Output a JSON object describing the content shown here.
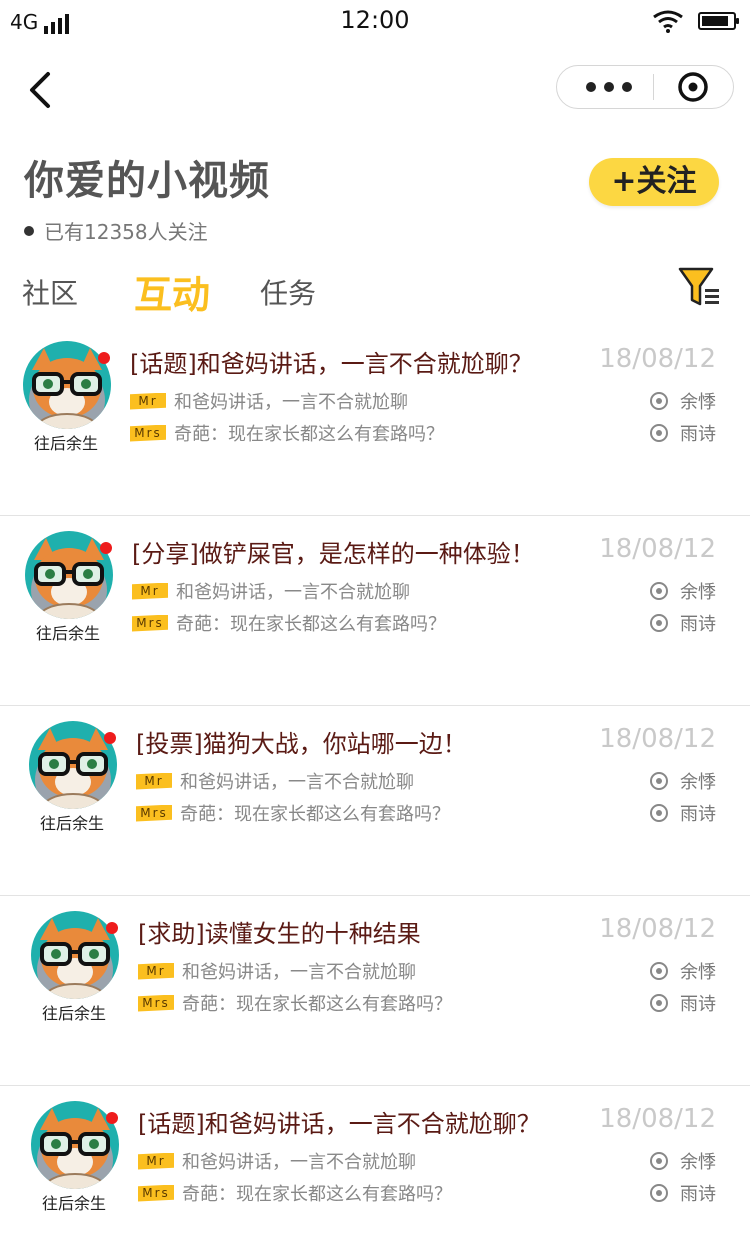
{
  "status_bar": {
    "network": "4G",
    "time": "12:00"
  },
  "header": {
    "title": "你爱的小视频",
    "follow_label": "+关注",
    "followers_text": "已有12358人关注"
  },
  "tabs": [
    {
      "label": "社区"
    },
    {
      "label": "互动"
    },
    {
      "label": "任务"
    }
  ],
  "active_tab": "互动",
  "posts": [
    {
      "avatar_name": "往后余生",
      "title": "[话题]和爸妈讲话，一言不合就尬聊？",
      "date": "18/08/12",
      "reply1_tag": "Mr",
      "reply1_text": "和爸妈讲话，一言不合就尬聊",
      "reply2_tag": "Mrs",
      "reply2_text": "奇葩：现在家长都这么有套路吗？",
      "user1": "余悸",
      "user2": "雨诗"
    },
    {
      "avatar_name": "往后余生",
      "title": "[分享]做铲屎官，是怎样的一种体验！",
      "date": "18/08/12",
      "reply1_tag": "Mr",
      "reply1_text": "和爸妈讲话，一言不合就尬聊",
      "reply2_tag": "Mrs",
      "reply2_text": "奇葩：现在家长都这么有套路吗？",
      "user1": "余悸",
      "user2": "雨诗"
    },
    {
      "avatar_name": "往后余生",
      "title": "[投票]猫狗大战，你站哪一边！",
      "date": "18/08/12",
      "reply1_tag": "Mr",
      "reply1_text": "和爸妈讲话，一言不合就尬聊",
      "reply2_tag": "Mrs",
      "reply2_text": "奇葩：现在家长都这么有套路吗？",
      "user1": "余悸",
      "user2": "雨诗"
    },
    {
      "avatar_name": "往后余生",
      "title": "[求助]读懂女生的十种结果",
      "date": "18/08/12",
      "reply1_tag": "Mr",
      "reply1_text": "和爸妈讲话，一言不合就尬聊",
      "reply2_tag": "Mrs",
      "reply2_text": "奇葩：现在家长都这么有套路吗？",
      "user1": "余悸",
      "user2": "雨诗"
    },
    {
      "avatar_name": "往后余生",
      "title": "[话题]和爸妈讲话，一言不合就尬聊？",
      "date": "18/08/12",
      "reply1_tag": "Mr",
      "reply1_text": "和爸妈讲话，一言不合就尬聊",
      "reply2_tag": "Mrs",
      "reply2_text": "奇葩：现在家长都这么有套路吗？",
      "user1": "余悸",
      "user2": "雨诗"
    }
  ],
  "colors": {
    "accent": "#fbbf1f",
    "follow_button": "#fcd742",
    "title_text": "#5a1a14",
    "date_text": "#c9c9c9"
  },
  "icons": {
    "back": "chevron-left-icon",
    "more": "more-dots-icon",
    "close": "target-icon",
    "filter": "filter-icon",
    "badge": "red-dot-icon",
    "user": "radio-icon"
  }
}
